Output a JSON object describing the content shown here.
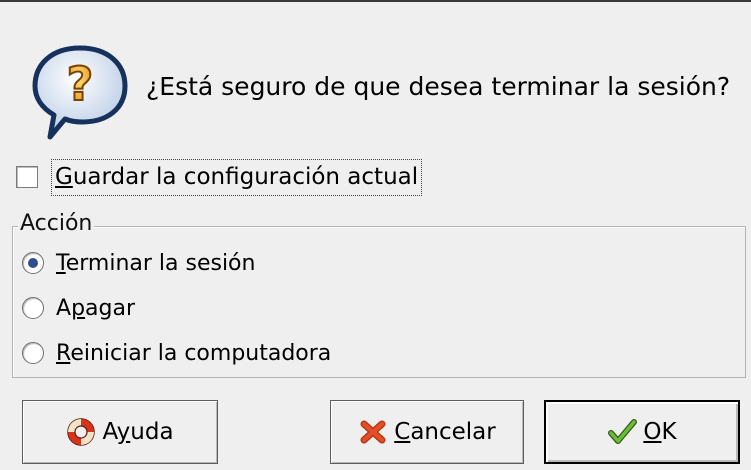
{
  "dialog": {
    "question": "¿Está seguro de que desea terminar la sesión?",
    "save_setup": {
      "mnemonic": "G",
      "rest": "uardar la configuración actual",
      "checked": false
    },
    "action_frame": {
      "title": "Acción",
      "options": [
        {
          "mnemonic": "T",
          "rest": "erminar la sesión",
          "prefix": "",
          "checked": true
        },
        {
          "prefix": "A",
          "mnemonic": "p",
          "rest": "agar",
          "checked": false
        },
        {
          "mnemonic": "R",
          "rest": "einiciar la computadora",
          "prefix": "",
          "checked": false
        }
      ]
    },
    "buttons": {
      "help": {
        "prefix": "A",
        "mnemonic": "y",
        "rest": "uda",
        "icon": "lifebuoy-icon"
      },
      "cancel": {
        "mnemonic": "C",
        "rest": "ancelar",
        "prefix": "",
        "icon": "close-x-icon"
      },
      "ok": {
        "mnemonic": "O",
        "rest": "K",
        "prefix": "",
        "icon": "checkmark-icon"
      }
    },
    "colors": {
      "background": "#efefef",
      "radio_selected": "#2f4e90",
      "cancel_icon": "#e05028",
      "ok_icon": "#4f9a2f"
    }
  }
}
